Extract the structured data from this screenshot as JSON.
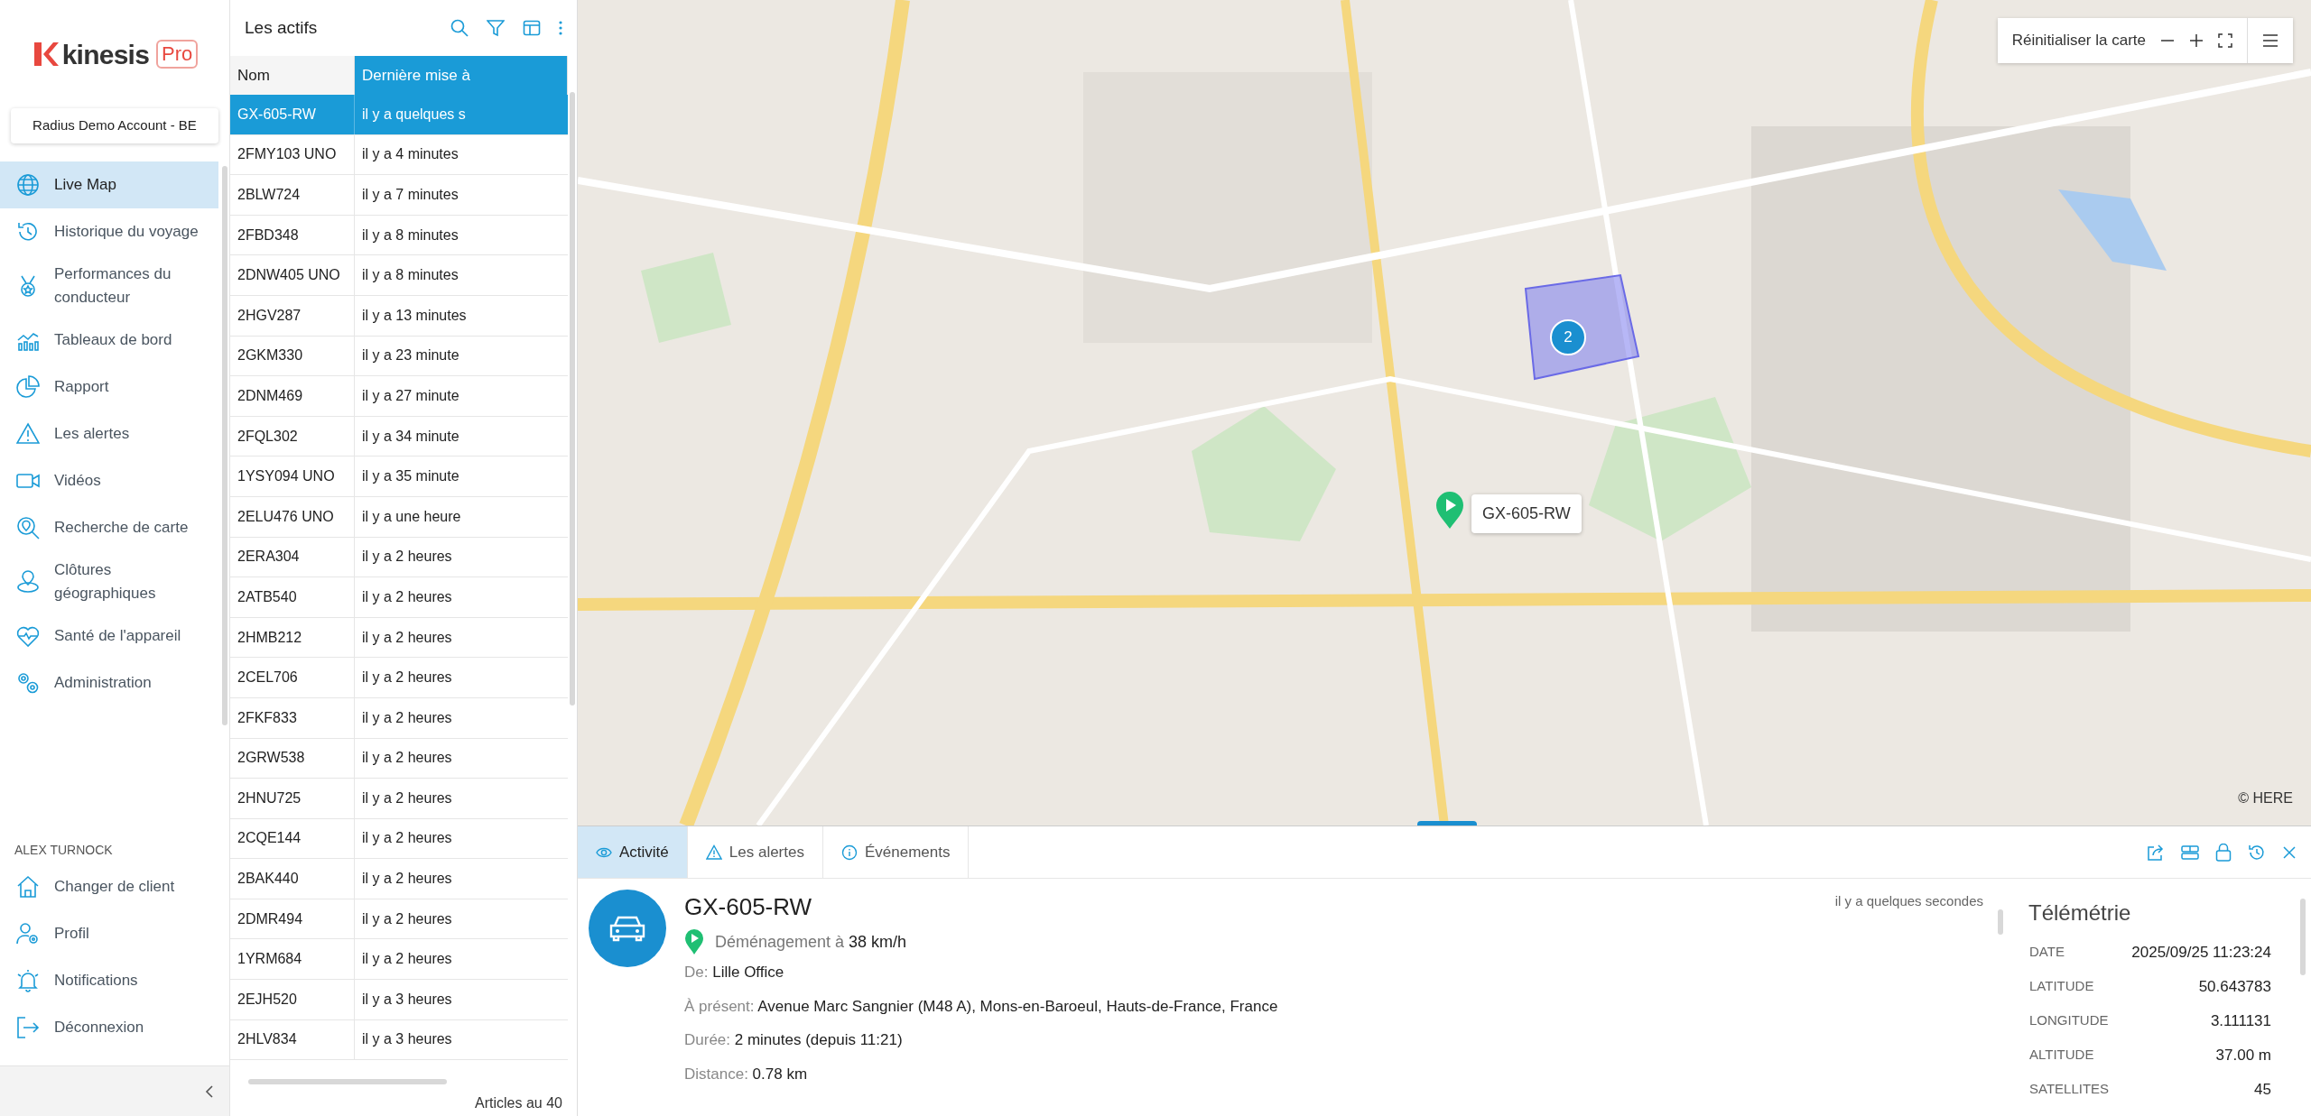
{
  "brand": {
    "name": "kinesis",
    "badge": "Pro"
  },
  "account": "Radius Demo Account - BE",
  "nav": [
    {
      "label": "Live Map",
      "selected": true
    },
    {
      "label": "Historique du voyage",
      "selected": false
    },
    {
      "label": "Performances du conducteur",
      "selected": false
    },
    {
      "label": "Tableaux de bord",
      "selected": false
    },
    {
      "label": "Rapport",
      "selected": false
    },
    {
      "label": "Les alertes",
      "selected": false
    },
    {
      "label": "Vidéos",
      "selected": false
    },
    {
      "label": "Recherche de carte",
      "selected": false
    },
    {
      "label": "Clôtures géographiques",
      "selected": false
    },
    {
      "label": "Santé de l'appareil",
      "selected": false
    },
    {
      "label": "Administration",
      "selected": false
    }
  ],
  "user": {
    "name": "ALEX TURNOCK"
  },
  "user_menu": [
    {
      "label": "Changer de client"
    },
    {
      "label": "Profil"
    },
    {
      "label": "Notifications"
    },
    {
      "label": "Déconnexion"
    }
  ],
  "assets": {
    "title": "Les actifs",
    "columns": [
      "Nom",
      "Dernière mise à"
    ],
    "rows": [
      {
        "name": "GX-605-RW",
        "updated": "il y a quelques s",
        "selected": true
      },
      {
        "name": "2FMY103 UNO",
        "updated": "il y a 4 minutes",
        "selected": false
      },
      {
        "name": "2BLW724",
        "updated": "il y a 7 minutes",
        "selected": false
      },
      {
        "name": "2FBD348",
        "updated": "il y a 8 minutes",
        "selected": false
      },
      {
        "name": "2DNW405 UNO",
        "updated": "il y a 8 minutes",
        "selected": false
      },
      {
        "name": "2HGV287",
        "updated": "il y a 13 minutes",
        "selected": false
      },
      {
        "name": "2GKM330",
        "updated": "il y a 23 minute",
        "selected": false
      },
      {
        "name": "2DNM469",
        "updated": "il y a 27 minute",
        "selected": false
      },
      {
        "name": "2FQL302",
        "updated": "il y a 34 minute",
        "selected": false
      },
      {
        "name": "1YSY094 UNO",
        "updated": "il y a 35 minute",
        "selected": false
      },
      {
        "name": "2ELU476 UNO",
        "updated": "il y a une heure",
        "selected": false
      },
      {
        "name": "2ERA304",
        "updated": "il y a 2 heures",
        "selected": false
      },
      {
        "name": "2ATB540",
        "updated": "il y a 2 heures",
        "selected": false
      },
      {
        "name": "2HMB212",
        "updated": "il y a 2 heures",
        "selected": false
      },
      {
        "name": "2CEL706",
        "updated": "il y a 2 heures",
        "selected": false
      },
      {
        "name": "2FKF833",
        "updated": "il y a 2 heures",
        "selected": false
      },
      {
        "name": "2GRW538",
        "updated": "il y a 2 heures",
        "selected": false
      },
      {
        "name": "2HNU725",
        "updated": "il y a 2 heures",
        "selected": false
      },
      {
        "name": "2CQE144",
        "updated": "il y a 2 heures",
        "selected": false
      },
      {
        "name": "2BAK440",
        "updated": "il y a 2 heures",
        "selected": false
      },
      {
        "name": "2DMR494",
        "updated": "il y a 2 heures",
        "selected": false
      },
      {
        "name": "1YRM684",
        "updated": "il y a 2 heures",
        "selected": false
      },
      {
        "name": "2EJH520",
        "updated": "il y a 3 heures",
        "selected": false
      },
      {
        "name": "2HLV834",
        "updated": "il y a 3 heures",
        "selected": false
      }
    ],
    "footer": "Articles au 40"
  },
  "map": {
    "reset": "Réinitialiser la carte",
    "cluster": "2",
    "marker_label": "GX-605-RW",
    "attribution": "© HERE"
  },
  "detail": {
    "tabs": [
      {
        "label": "Activité",
        "selected": true
      },
      {
        "label": "Les alertes",
        "selected": false
      },
      {
        "label": "Événements",
        "selected": false
      }
    ],
    "title": "GX-605-RW",
    "time": "il y a quelques secondes",
    "status": {
      "label": "Déménagement à",
      "value": "38 km/h"
    },
    "fields": [
      {
        "label": "De:",
        "value": "Lille Office"
      },
      {
        "label": "À présent:",
        "value": "Avenue Marc Sangnier (M48 A), Mons-en-Baroeul, Hauts-de-France, France"
      },
      {
        "label": "Durée:",
        "value": "2 minutes (depuis 11:21)"
      },
      {
        "label": "Distance:",
        "value": "0.78 km"
      }
    ],
    "telemetry": {
      "title": "Télémétrie",
      "rows": [
        {
          "label": "DATE",
          "value": "2025/09/25 11:23:24"
        },
        {
          "label": "LATITUDE",
          "value": "50.643783"
        },
        {
          "label": "LONGITUDE",
          "value": "3.111131"
        },
        {
          "label": "ALTITUDE",
          "value": "37.00 m"
        },
        {
          "label": "SATELLITES",
          "value": "45"
        }
      ]
    }
  }
}
